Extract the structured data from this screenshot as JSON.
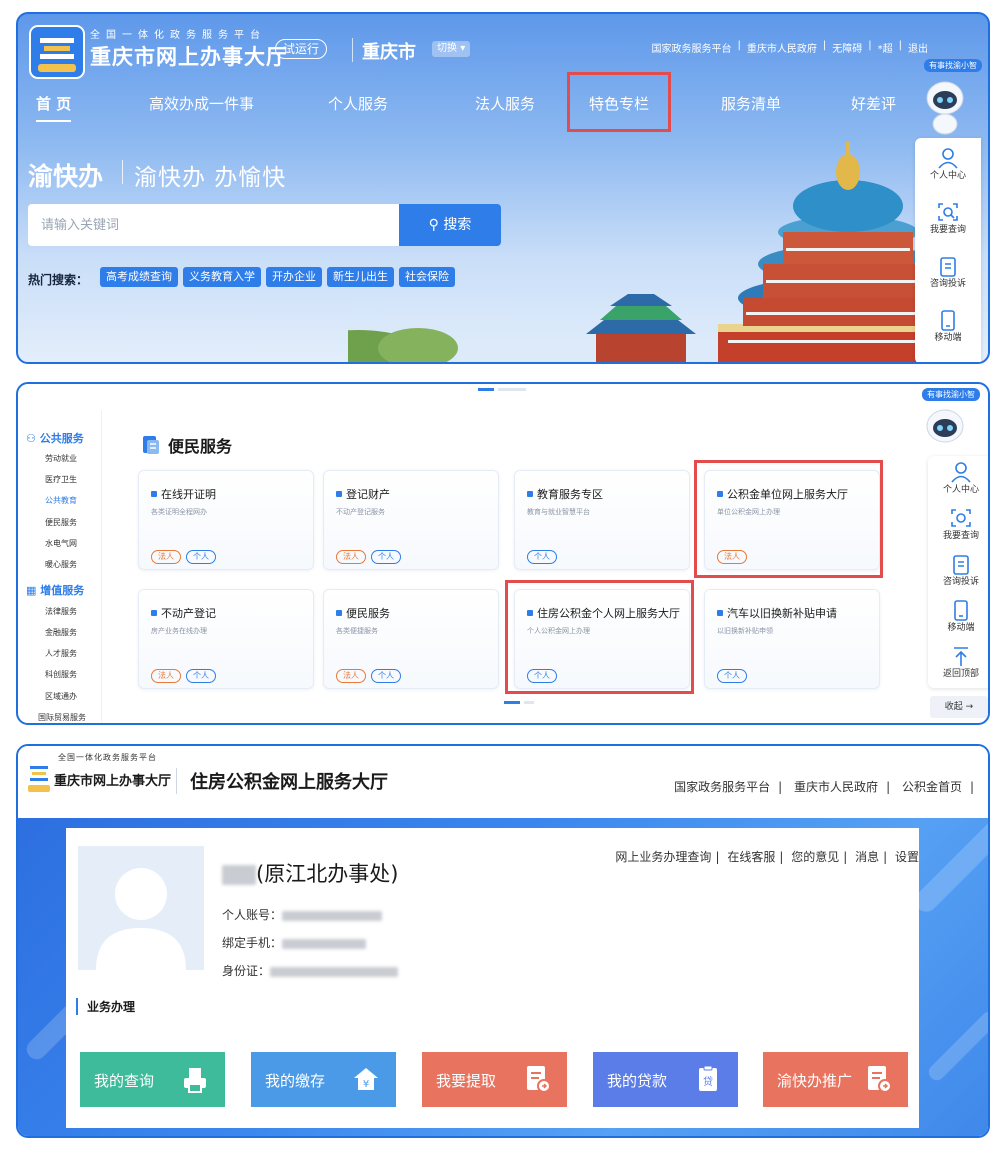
{
  "panel1": {
    "site_subtitle": "全国一体化政务服务平台",
    "site_title": "重庆市网上办事大厅",
    "trial_badge": "试运行",
    "city": "重庆市",
    "switch_label": "切换",
    "top_links": [
      "国家政务服务平台",
      "重庆市人民政府",
      "无障碍",
      "*超",
      "退出"
    ],
    "assistant_badge": "有事找渝小智",
    "nav": [
      "首 页",
      "高效办成一件事",
      "个人服务",
      "法人服务",
      "特色专栏",
      "服务清单",
      "好差评"
    ],
    "slogan_main": "渝快办",
    "slogan_sub": "渝快办 办愉快",
    "search_placeholder": "请输入关键词",
    "search_button": "搜索",
    "hot_label": "热门搜索：",
    "hot_tags": [
      "高考成绩查询",
      "义务教育入学",
      "开办企业",
      "新生儿出生",
      "社会保险"
    ],
    "dock": [
      "个人中心",
      "我要查询",
      "咨询投诉",
      "移动端"
    ]
  },
  "panel2": {
    "assistant_badge": "有事找渝小智",
    "menu": [
      {
        "group": "公共服务",
        "items": [
          "劳动就业",
          "医疗卫生",
          "公共教育",
          "便民服务",
          "水电气网",
          "暖心服务"
        ]
      },
      {
        "group": "增值服务",
        "items": [
          "法律服务",
          "金融服务",
          "人才服务",
          "科创服务",
          "区域通办",
          "国际贸易服务"
        ]
      }
    ],
    "section_title": "便民服务",
    "cards": [
      {
        "title": "在线开证明",
        "desc": "各类证明全程网办",
        "tags": [
          "法人",
          "个人"
        ]
      },
      {
        "title": "登记财产",
        "desc": "不动产登记服务",
        "tags": [
          "法人",
          "个人"
        ]
      },
      {
        "title": "教育服务专区",
        "desc": "教育与就业智慧平台",
        "tags": [
          "个人"
        ]
      },
      {
        "title": "公积金单位网上服务大厅",
        "desc": "单位公积金网上办理",
        "tags": [
          "法人"
        ]
      },
      {
        "title": "不动产登记",
        "desc": "房产业务在线办理",
        "tags": [
          "法人",
          "个人"
        ]
      },
      {
        "title": "便民服务",
        "desc": "各类便捷服务",
        "tags": [
          "法人",
          "个人"
        ]
      },
      {
        "title": "住房公积金个人网上服务大厅",
        "desc": "个人公积金网上办理",
        "tags": [
          "个人"
        ]
      },
      {
        "title": "汽车以旧换新补贴申请",
        "desc": "以旧换新补贴申领",
        "tags": [
          "个人"
        ]
      }
    ],
    "dock": [
      "个人中心",
      "我要查询",
      "咨询投诉",
      "移动端",
      "返回顶部"
    ],
    "collapse": "收起 →"
  },
  "panel3": {
    "logo_subtitle": "全国一体化政务服务平台",
    "logo_title": "重庆市网上办事大厅",
    "title": "住房公积金网上服务大厅",
    "header_links": [
      "国家政务服务平台",
      "重庆市人民政府",
      "公积金首页"
    ],
    "user_name_suffix": "(原江北办事处)",
    "account_label": "个人账号：",
    "phone_label": "绑定手机：",
    "id_label": "身份证：",
    "user_links": [
      "网上业务办理查询",
      "在线客服",
      "您的意见",
      "消息",
      "设置"
    ],
    "biz_label": "业务办理",
    "tiles": [
      {
        "label": "我的查询",
        "color": "#3dbb9a",
        "icon": "printer-icon"
      },
      {
        "label": "我的缴存",
        "color": "#4a9ae8",
        "icon": "house-yen-icon"
      },
      {
        "label": "我要提取",
        "color": "#e8735e",
        "icon": "document-withdraw-icon"
      },
      {
        "label": "我的贷款",
        "color": "#5b7de8",
        "icon": "loan-clipboard-icon"
      },
      {
        "label": "渝快办推广",
        "color": "#e8735e",
        "icon": "document-promote-icon"
      }
    ]
  },
  "colors": {
    "primary": "#2f7de8",
    "highlight": "#e24c4c",
    "faren_tag": "#e8793a"
  }
}
